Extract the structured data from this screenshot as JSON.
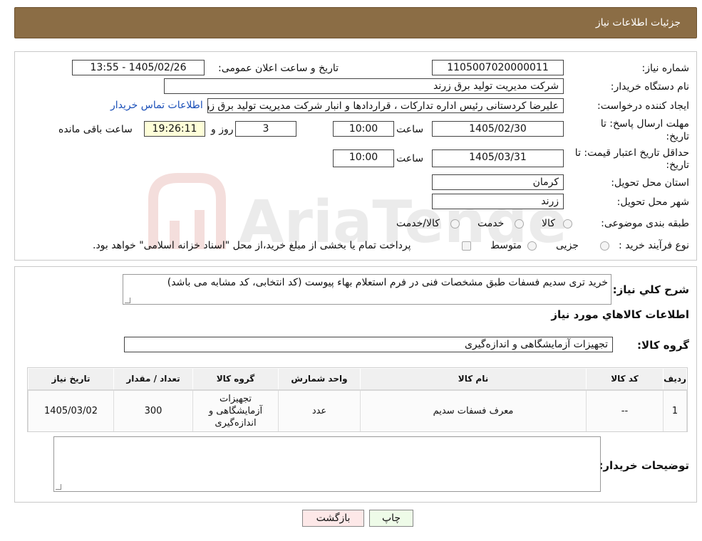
{
  "header": {
    "title": "جزئیات اطلاعات نیاز"
  },
  "form": {
    "need_number_label": "شماره نیاز:",
    "need_number": "1105007020000011",
    "announce_label": "تاریخ و ساعت اعلان عمومی:",
    "announce_value": "1405/02/26 - 13:55",
    "buyer_org_label": "نام دستگاه خریدار:",
    "buyer_org": "شرکت مدیریت تولید برق زرند",
    "creator_label": "ایجاد کننده درخواست:",
    "creator": "علیرضا کردستانی رئیس اداره تدارکات ، قراردادها و انبار  شرکت مدیریت تولید برق زرند",
    "contact_link": "اطلاعات تماس خریدار",
    "deadline_label_1": "مهلت ارسال پاسخ: تا",
    "deadline_label_2": "تاریخ:",
    "deadline_date": "1405/02/30",
    "time_label": "ساعت",
    "deadline_time": "10:00",
    "days_value": "3",
    "days_label": "روز و",
    "remaining_time": "19:26:11",
    "remaining_label": "ساعت باقی مانده",
    "validity_label_1": "حداقل تاریخ اعتبار قیمت: تا",
    "validity_label_2": "تاریخ:",
    "validity_date": "1405/03/31",
    "validity_time_label": "ساعت",
    "validity_time": "10:00",
    "province_label": "استان محل تحویل:",
    "province": "کرمان",
    "city_label": "شهر محل تحویل:",
    "city": "زرند",
    "category_label": "طبقه بندی موضوعی:",
    "category_options": [
      "کالا",
      "خدمت",
      "کالا/خدمت"
    ],
    "process_label": "نوع فرآیند خرید :",
    "process_options": [
      "جزیی",
      "متوسط"
    ],
    "process_note": "پرداخت تمام یا بخشی از مبلغ خرید،از محل \"اسناد خزانه اسلامی\" خواهد بود."
  },
  "watermark": {
    "text": "AriaTender.neT"
  },
  "details": {
    "summary_label": "شرح کلي نياز:",
    "summary": "خرید تری سدیم فسفات طبق مشخصات فنی در فرم استعلام بهاء پیوست (کد انتخابی، کد مشابه می باشد)",
    "goods_info_title": "اطلاعات کالاهاي مورد نياز",
    "goods_group_label": "گروه کالا:",
    "goods_group": "تجهیزات آزمایشگاهی و اندازه‌گیری",
    "table_headers": [
      "ردیف",
      "کد کالا",
      "نام کالا",
      "واحد شمارش",
      "گروه کالا",
      "تعداد / مقدار",
      "تاریخ نیاز"
    ],
    "rows": [
      [
        "1",
        "--",
        "معرف فسفات سدیم",
        "عدد",
        "تجهیزات آزمایشگاهی و اندازه‌گیری",
        "300",
        "1405/03/02"
      ]
    ],
    "buyer_notes_label": "توضیحات خریدار:"
  },
  "actions": {
    "print": "چاپ",
    "back": "بازگشت"
  },
  "colors": {
    "header_bg": "#8b6d45",
    "link": "#1a4fb8",
    "back_button": "#fde8e8",
    "print_button": "#eefbe8"
  }
}
